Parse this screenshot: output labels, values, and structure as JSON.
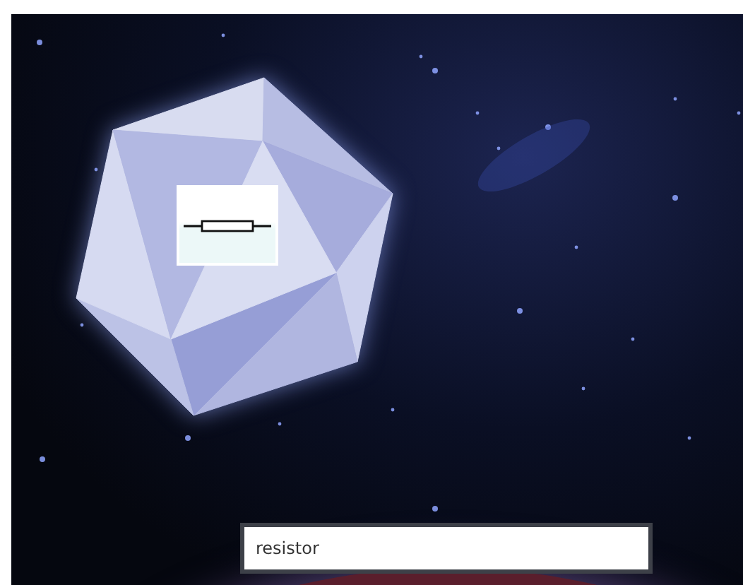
{
  "card": {
    "kind": "resistor"
  },
  "answer": {
    "value": "resistor"
  }
}
